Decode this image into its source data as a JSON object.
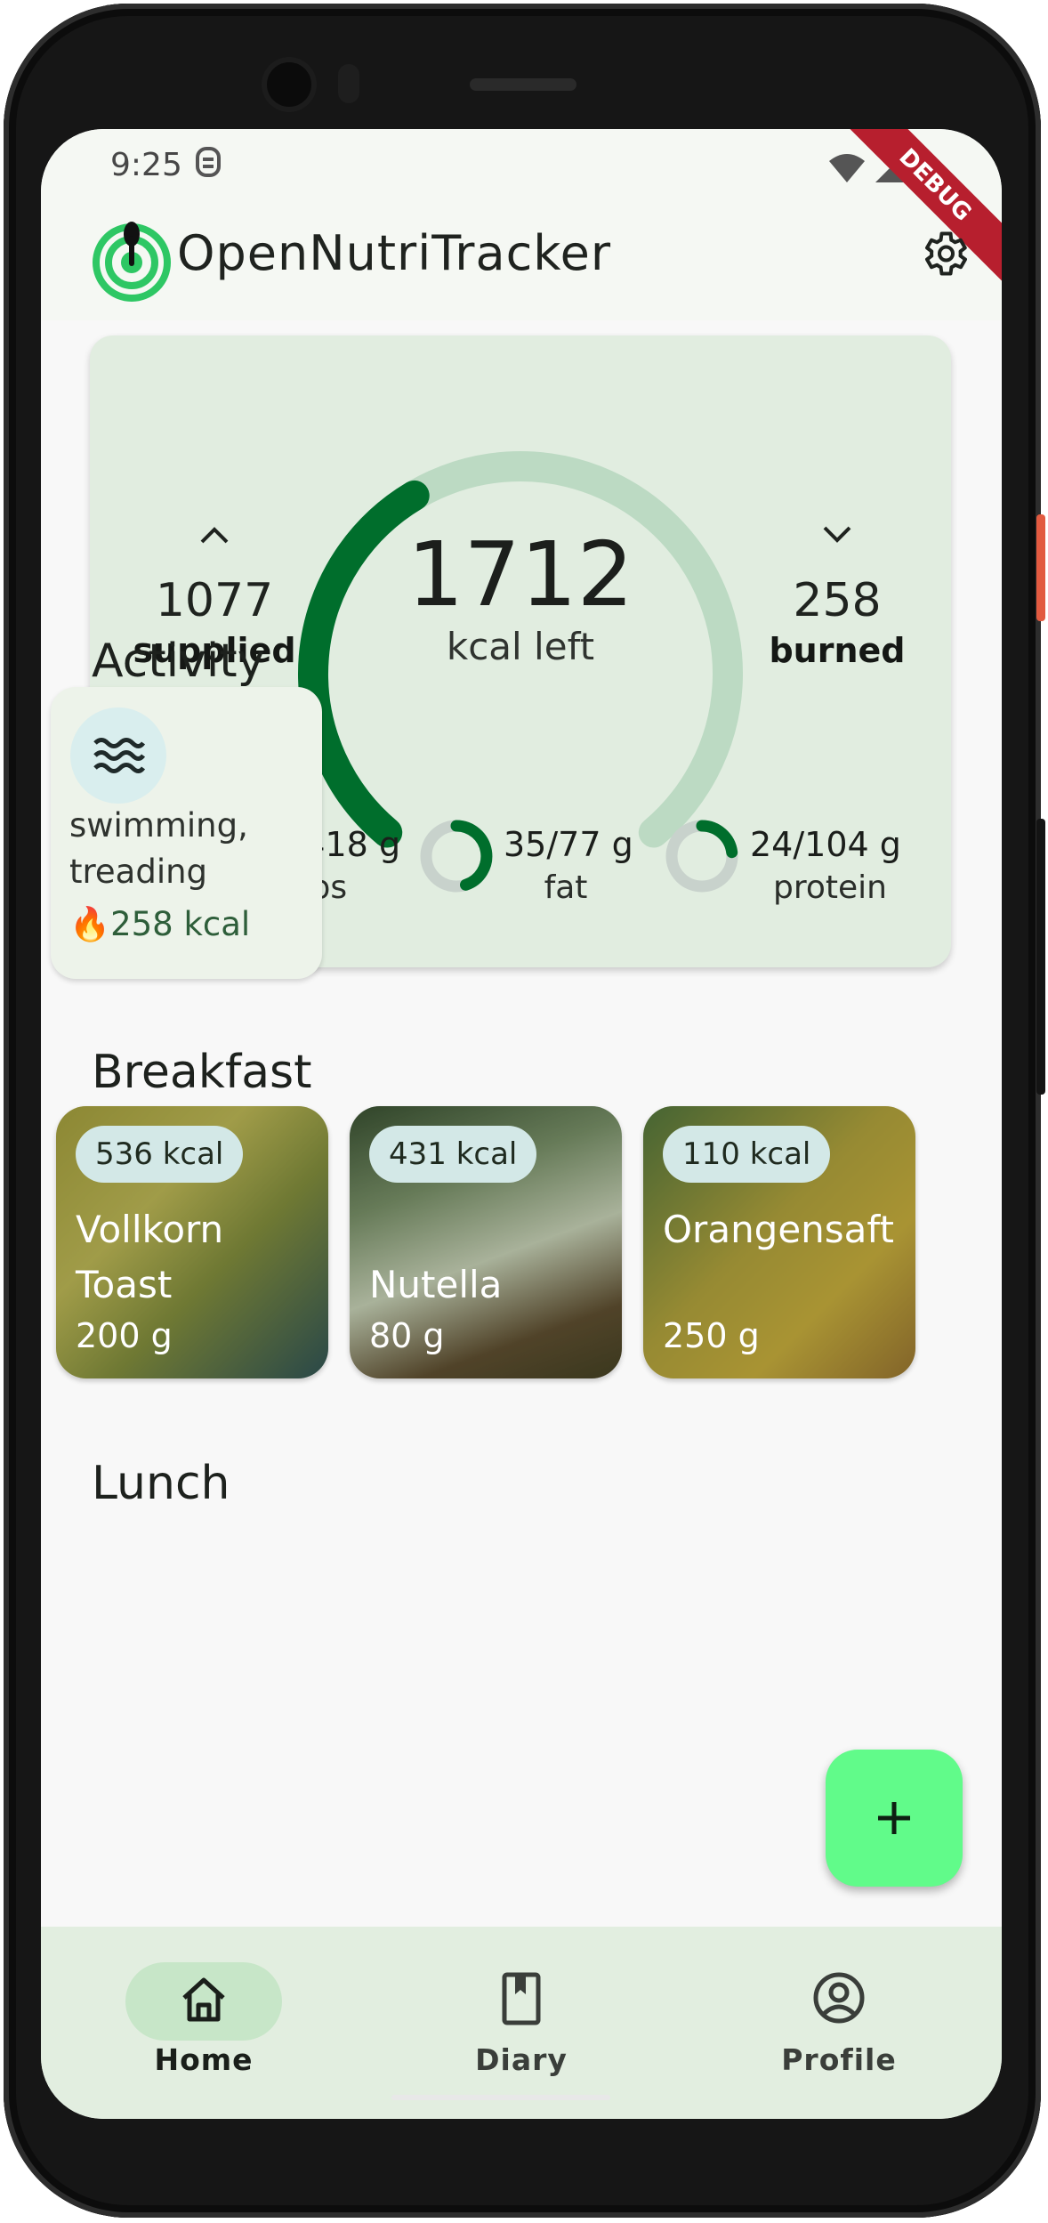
{
  "status_bar": {
    "time": "9:25"
  },
  "debug_banner": "DEBUG",
  "app": {
    "title": "OpenNutriTracker"
  },
  "summary": {
    "kcal_left": "1712",
    "kcal_left_label": "kcal left",
    "supplied_value": "1077",
    "supplied_label": "supplied",
    "burned_value": "258",
    "burned_label": "burned",
    "calorie_progress": 0.39,
    "macros": [
      {
        "value": "156/418 g",
        "label": "carbs",
        "progress": 0.37
      },
      {
        "value": "35/77 g",
        "label": "fat",
        "progress": 0.45
      },
      {
        "value": "24/104 g",
        "label": "protein",
        "progress": 0.23
      }
    ],
    "colors": {
      "accent": "#006e2c",
      "track": "#bcdac3",
      "ring_track": "#c8d2cc"
    }
  },
  "activity": {
    "heading": "Activity",
    "items": [
      {
        "name": "swimming, treading",
        "kcal": "258 kcal",
        "icon": "waves-icon"
      }
    ]
  },
  "breakfast": {
    "heading": "Breakfast",
    "items": [
      {
        "kcal": "536 kcal",
        "name": "Vollkorn Toast",
        "weight": "200 g"
      },
      {
        "kcal": "431 kcal",
        "name": "Nutella",
        "weight": "80 g"
      },
      {
        "kcal": "110 kcal",
        "name": "Orangensaft",
        "weight": "250 g"
      }
    ]
  },
  "lunch": {
    "heading": "Lunch"
  },
  "fab": {
    "icon": "plus-icon"
  },
  "nav": {
    "items": [
      {
        "label": "Home",
        "icon": "home-icon",
        "active": true
      },
      {
        "label": "Diary",
        "icon": "book-icon",
        "active": false
      },
      {
        "label": "Profile",
        "icon": "account-circle-icon",
        "active": false
      }
    ]
  }
}
